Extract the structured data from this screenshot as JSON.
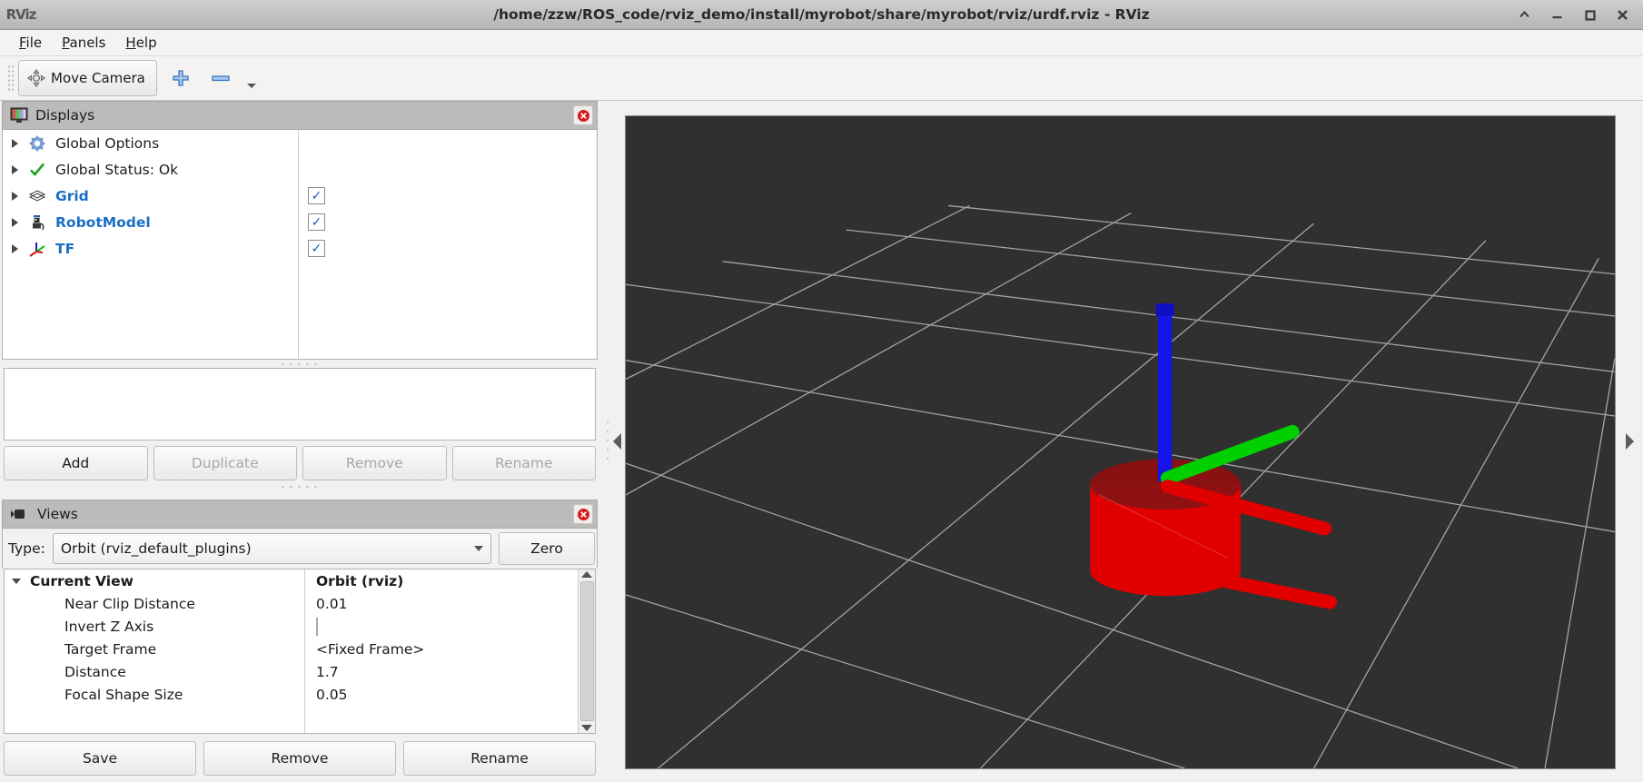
{
  "window": {
    "title": "/home/zzw/ROS_code/rviz_demo/install/myrobot/share/myrobot/rviz/urdf.rviz - RViz",
    "app_icon_text": "RViz",
    "controls": {
      "shade": "∧",
      "minimize": "–",
      "maximize": "□",
      "close": "✕"
    }
  },
  "menubar": {
    "items": [
      {
        "label": "File",
        "mnemonic": "F",
        "rest": "ile"
      },
      {
        "label": "Panels",
        "mnemonic": "P",
        "rest": "anels"
      },
      {
        "label": "Help",
        "mnemonic": "H",
        "rest": "elp"
      }
    ]
  },
  "toolbar": {
    "move_camera_label": "Move Camera",
    "move_camera_icon": "move-camera-icon",
    "add_tool_icon": "plus-icon",
    "remove_tool_icon": "minus-icon",
    "overflow_icon": "chevron-down-icon"
  },
  "displays_panel": {
    "title": "Displays",
    "title_icon": "displays-monitor-icon",
    "close_icon": "close-icon",
    "tree": [
      {
        "label": "Global Options",
        "icon": "gear-icon",
        "bold": false,
        "checkbox": null
      },
      {
        "label": "Global Status: Ok",
        "icon": "check-icon",
        "bold": false,
        "checkbox": null
      },
      {
        "label": "Grid",
        "icon": "grid-icon",
        "bold": true,
        "checkbox": true
      },
      {
        "label": "RobotModel",
        "icon": "robot-icon",
        "bold": true,
        "checkbox": true
      },
      {
        "label": "TF",
        "icon": "tf-axes-icon",
        "bold": true,
        "checkbox": true
      }
    ],
    "description": "",
    "buttons": [
      {
        "label": "Add",
        "enabled": true
      },
      {
        "label": "Duplicate",
        "enabled": false
      },
      {
        "label": "Remove",
        "enabled": false
      },
      {
        "label": "Rename",
        "enabled": false
      }
    ]
  },
  "views_panel": {
    "title": "Views",
    "title_icon": "camera-icon",
    "close_icon": "close-icon",
    "type_label": "Type:",
    "type_value": "Orbit (rviz_default_plugins)",
    "zero_label": "Zero",
    "properties": [
      {
        "name": "Current View",
        "value": "Orbit (rviz)",
        "kind": "header"
      },
      {
        "name": "Near Clip Distance",
        "value": "0.01",
        "kind": "text"
      },
      {
        "name": "Invert Z Axis",
        "value": "",
        "kind": "checkbox"
      },
      {
        "name": "Target Frame",
        "value": "<Fixed Frame>",
        "kind": "text"
      },
      {
        "name": "Distance",
        "value": "1.7",
        "kind": "text"
      },
      {
        "name": "Focal Shape Size",
        "value": "0.05",
        "kind": "text"
      }
    ],
    "buttons": [
      {
        "label": "Save",
        "enabled": true
      },
      {
        "label": "Remove",
        "enabled": true
      },
      {
        "label": "Rename",
        "enabled": true
      }
    ]
  },
  "viewport": {
    "background_color": "#303030",
    "grid_color": "#b9b9b9",
    "robot_body_color": "#e00000",
    "axis_x_color": "#e00000",
    "axis_y_color": "#00d000",
    "axis_z_color": "#1414e6",
    "collapse_left_icon": "collapse-left-arrow-icon",
    "collapse_right_icon": "collapse-right-arrow-icon"
  }
}
